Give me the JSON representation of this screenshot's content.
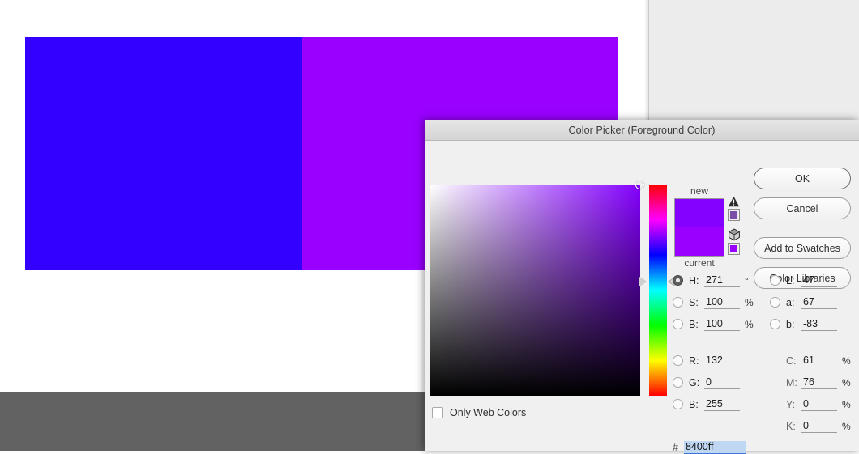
{
  "document": {
    "swatch_left_color": "#3300ff",
    "swatch_right_color": "#9900ff",
    "bottom_strip_color": "#626262",
    "panel_color": "#ececec"
  },
  "dialog": {
    "title": "Color Picker (Foreground Color)",
    "preview": {
      "new_label": "new",
      "current_label": "current",
      "new_color": "#8400ff",
      "current_color": "#9900ff"
    },
    "gamut_warning": {
      "icon": "warning-triangle-icon",
      "chip_color": "#7a4fa8"
    },
    "web_warning": {
      "icon": "web-cube-icon",
      "chip_color": "#9900ff"
    },
    "buttons": [
      {
        "id": "ok",
        "label": "OK"
      },
      {
        "id": "cancel",
        "label": "Cancel"
      },
      {
        "id": "add-to-swatches",
        "label": "Add to Swatches"
      },
      {
        "id": "color-libraries",
        "label": "Color Libraries"
      }
    ],
    "only_web_colors": {
      "label": "Only Web Colors",
      "checked": false
    },
    "hex": {
      "symbol": "#",
      "value": "8400ff",
      "selected": true
    },
    "fields": {
      "hsb": [
        {
          "id": "h",
          "label": "H:",
          "value": "271",
          "unit": "°",
          "selected": true
        },
        {
          "id": "s",
          "label": "S:",
          "value": "100",
          "unit": "%",
          "selected": false
        },
        {
          "id": "b",
          "label": "B:",
          "value": "100",
          "unit": "%",
          "selected": false
        }
      ],
      "rgb": [
        {
          "id": "r",
          "label": "R:",
          "value": "132",
          "unit": "",
          "selected": false
        },
        {
          "id": "g",
          "label": "G:",
          "value": "0",
          "unit": "",
          "selected": false
        },
        {
          "id": "b2",
          "label": "B:",
          "value": "255",
          "unit": "",
          "selected": false
        }
      ],
      "lab": [
        {
          "id": "l",
          "label": "L:",
          "value": "47",
          "unit": "",
          "selected": false
        },
        {
          "id": "a",
          "label": "a:",
          "value": "67",
          "unit": "",
          "selected": false
        },
        {
          "id": "blab",
          "label": "b:",
          "value": "-83",
          "unit": "",
          "selected": false
        }
      ],
      "cmyk": [
        {
          "id": "c",
          "label": "C:",
          "value": "61",
          "unit": "%"
        },
        {
          "id": "m",
          "label": "M:",
          "value": "76",
          "unit": "%"
        },
        {
          "id": "y",
          "label": "Y:",
          "value": "0",
          "unit": "%"
        },
        {
          "id": "k",
          "label": "K:",
          "value": "0",
          "unit": "%"
        }
      ]
    }
  }
}
